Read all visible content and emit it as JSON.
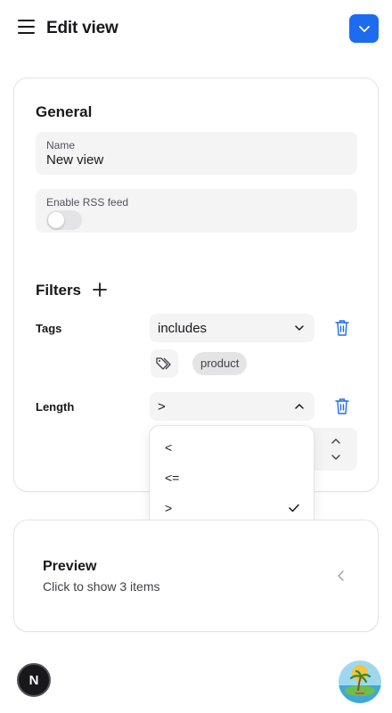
{
  "header": {
    "title": "Edit view",
    "menu_icon": "hamburger-menu-icon",
    "action_icon": "chevron-down-icon",
    "accent": "#1d6cf0"
  },
  "general": {
    "heading": "General",
    "name_label": "Name",
    "name_value": "New view",
    "rss_label": "Enable RSS feed",
    "rss_enabled": false
  },
  "filters": {
    "heading": "Filters",
    "tags": {
      "label": "Tags",
      "operator": "includes",
      "chips": [
        "product"
      ]
    },
    "length": {
      "label": "Length",
      "operator": ">"
    }
  },
  "dropdown": {
    "options": [
      "<",
      "<=",
      ">",
      ">="
    ],
    "selected": ">"
  },
  "preview": {
    "title": "Preview",
    "subtitle": "Click to show 3 items"
  },
  "footer": {
    "badge_letter": "N"
  }
}
